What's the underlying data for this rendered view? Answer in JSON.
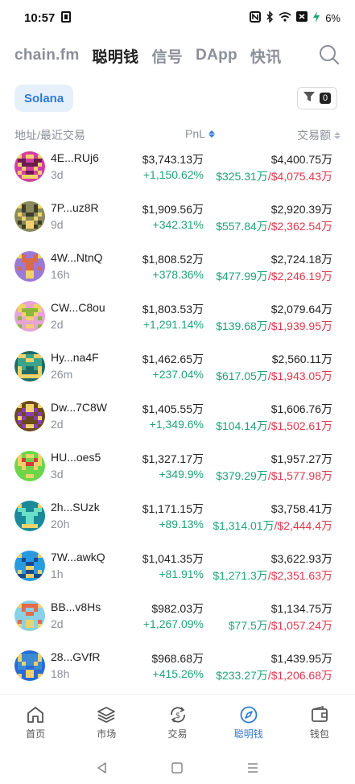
{
  "status_bar": {
    "time": "10:57",
    "battery": "6%"
  },
  "nav": {
    "tabs": [
      {
        "label": "chain.fm",
        "active": false
      },
      {
        "label": "聪明钱",
        "active": true
      },
      {
        "label": "信号",
        "active": false
      },
      {
        "label": "DApp",
        "active": false
      },
      {
        "label": "快讯",
        "active": false
      }
    ]
  },
  "chain_selector": {
    "label": "Solana"
  },
  "filter": {
    "count": "0"
  },
  "columns": {
    "address": "地址/最近交易",
    "pnl": "PnL",
    "volume": "交易额"
  },
  "wallets": [
    {
      "address": "4E...RUj6",
      "age": "3d",
      "pnl": "$3,743.13万",
      "pnl_pct": "+1,150.62%",
      "volume": "$4,400.75万",
      "buy": "$325.31万",
      "sell": "$4,075.43万",
      "colors": [
        "#d33ea5",
        "#6b1d4f"
      ]
    },
    {
      "address": "7P...uz8R",
      "age": "9d",
      "pnl": "$1,909.56万",
      "pnl_pct": "+342.31%",
      "volume": "$2,920.39万",
      "buy": "$557.84万",
      "sell": "$2,362.54万",
      "colors": [
        "#8a8a5a",
        "#3d3d2a"
      ]
    },
    {
      "address": "4W...NtnQ",
      "age": "16h",
      "pnl": "$1,808.52万",
      "pnl_pct": "+378.36%",
      "volume": "$2,724.18万",
      "buy": "$477.99万",
      "sell": "$2,246.19万",
      "colors": [
        "#9a7ad6",
        "#d96a4a"
      ]
    },
    {
      "address": "CW...C8ou",
      "age": "2d",
      "pnl": "$1,803.53万",
      "pnl_pct": "+1,291.14%",
      "volume": "$2,079.64万",
      "buy": "$139.68万",
      "sell": "$1,939.95万",
      "colors": [
        "#e6a3d6",
        "#8ab83a"
      ]
    },
    {
      "address": "Hy...na4F",
      "age": "26m",
      "pnl": "$1,462.65万",
      "pnl_pct": "+237.04%",
      "volume": "$2,560.11万",
      "buy": "$617.05万",
      "sell": "$1,943.05万",
      "colors": [
        "#1f6b63",
        "#3aa38a"
      ]
    },
    {
      "address": "Dw...7C8W",
      "age": "2d",
      "pnl": "$1,405.55万",
      "pnl_pct": "+1,349.6%",
      "volume": "$1,606.76万",
      "buy": "$104.14万",
      "sell": "$1,502.61万",
      "colors": [
        "#6b4a1a",
        "#8a3ab8"
      ]
    },
    {
      "address": "HU...oes5",
      "age": "3d",
      "pnl": "$1,327.17万",
      "pnl_pct": "+349.9%",
      "volume": "$1,957.27万",
      "buy": "$379.29万",
      "sell": "$1,577.98万",
      "colors": [
        "#6bd64a",
        "#d63a3a"
      ]
    },
    {
      "address": "2h...SUzk",
      "age": "20h",
      "pnl": "$1,171.15万",
      "pnl_pct": "+89.13%",
      "volume": "$3,758.41万",
      "buy": "$1,314.01万",
      "sell": "$2,444.4万",
      "colors": [
        "#1a8a9a",
        "#6be0c8"
      ]
    },
    {
      "address": "7W...awkQ",
      "age": "1h",
      "pnl": "$1,041.35万",
      "pnl_pct": "+81.91%",
      "volume": "$3,622.93万",
      "buy": "$1,271.3万",
      "sell": "$2,351.63万",
      "colors": [
        "#2a9ae0",
        "#1a4a8a"
      ]
    },
    {
      "address": "BB...v8Hs",
      "age": "2d",
      "pnl": "$982.03万",
      "pnl_pct": "+1,267.09%",
      "volume": "$1,134.75万",
      "buy": "$77.5万",
      "sell": "$1,057.24万",
      "colors": [
        "#8ad0e6",
        "#e66a4a"
      ]
    },
    {
      "address": "28...GVfR",
      "age": "18h",
      "pnl": "$968.68万",
      "pnl_pct": "+415.26%",
      "volume": "$1,439.95万",
      "buy": "$233.27万",
      "sell": "$1,206.68万",
      "colors": [
        "#2a6ad6",
        "#3a8ad6"
      ]
    }
  ],
  "bottom_nav": [
    {
      "label": "首页",
      "icon": "home-icon",
      "active": false
    },
    {
      "label": "市场",
      "icon": "layers-icon",
      "active": false
    },
    {
      "label": "交易",
      "icon": "swap-icon",
      "active": false
    },
    {
      "label": "聪明钱",
      "icon": "compass-icon",
      "active": true
    },
    {
      "label": "钱包",
      "icon": "wallet-icon",
      "active": false
    }
  ],
  "colors": {
    "accent": "#2f7ad8",
    "positive": "#1fa37a",
    "negative": "#e0384b"
  }
}
